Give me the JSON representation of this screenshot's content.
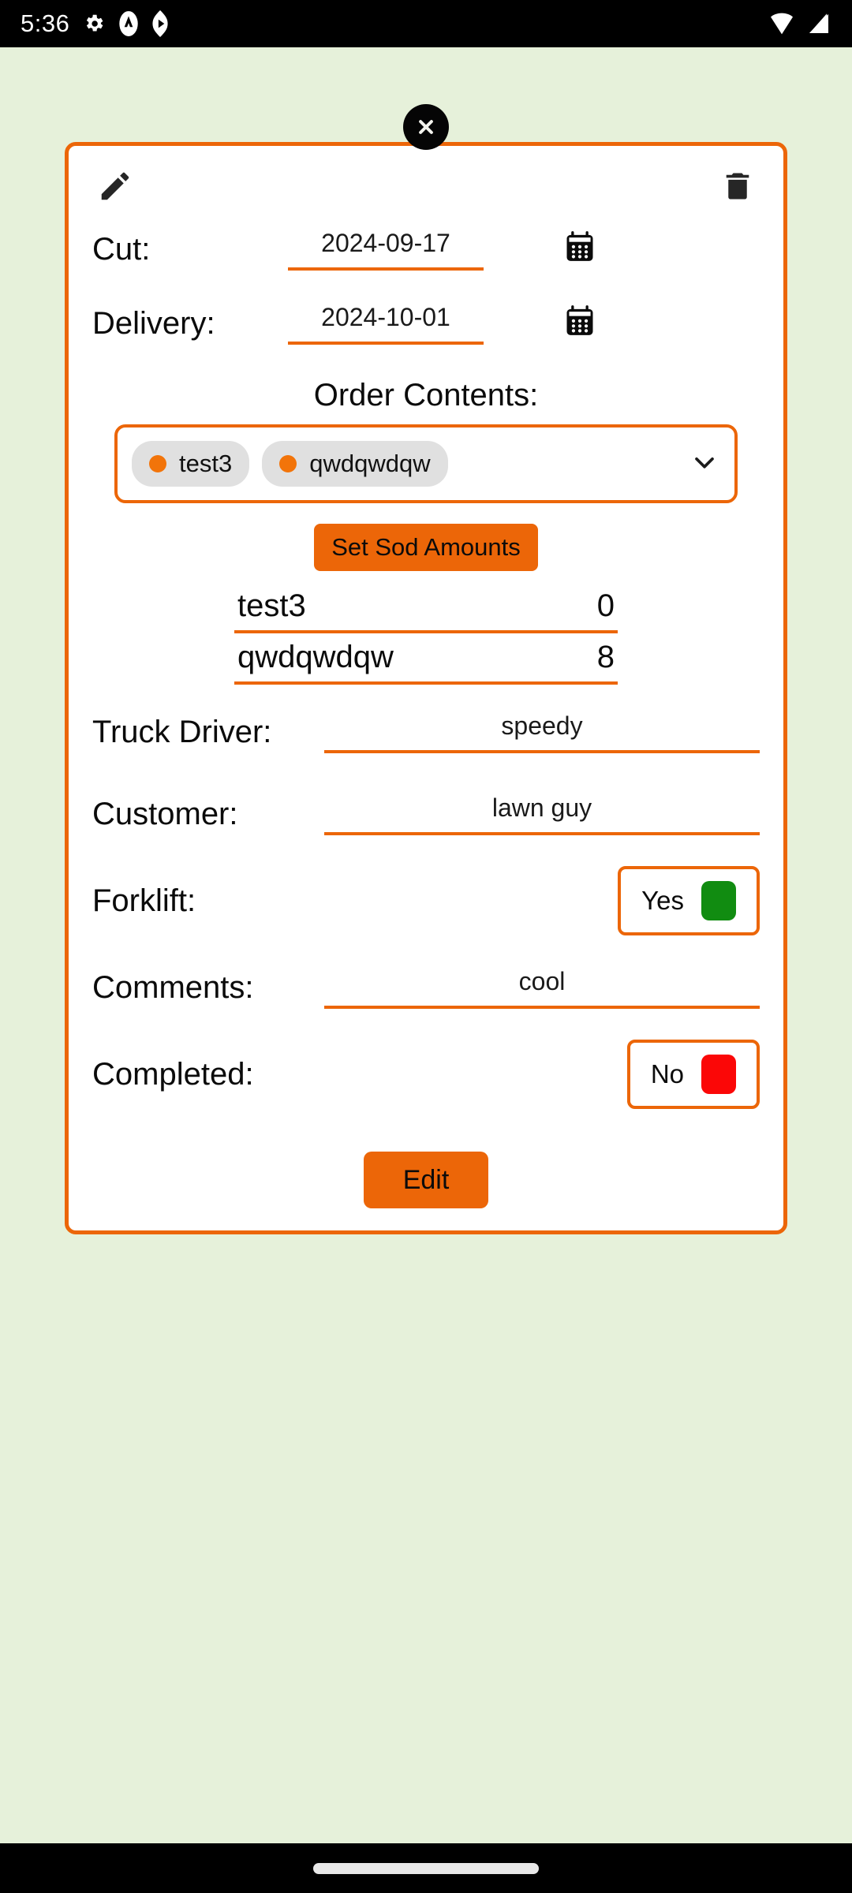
{
  "status_bar": {
    "time": "5:36",
    "left_icons": [
      "gear-icon",
      "android-head-icon",
      "play-badge-icon"
    ],
    "right_icons": [
      "wifi-icon",
      "signal-icon"
    ]
  },
  "colors": {
    "accent_orange": "#ec6608",
    "chip_dot_orange": "#f2740a",
    "background_green": "#e6f1da",
    "card_white": "#ffffff",
    "yes_green": "#118c11",
    "no_red": "#fb0707"
  },
  "dialog": {
    "close_label": "close",
    "header": {
      "edit_icon": "pencil-icon",
      "delete_icon": "trash-icon"
    },
    "fields": {
      "cut": {
        "label": "Cut:",
        "value": "2024-09-17",
        "icon": "calendar-icon"
      },
      "delivery": {
        "label": "Delivery:",
        "value": "2024-10-01",
        "icon": "calendar-icon"
      },
      "truck_driver": {
        "label": "Truck Driver:",
        "value": "speedy"
      },
      "customer": {
        "label": "Customer:",
        "value": "lawn guy"
      },
      "comments": {
        "label": "Comments:",
        "value": "cool"
      },
      "forklift": {
        "label": "Forklift:",
        "value": "Yes",
        "swatch": "#118c11"
      },
      "completed": {
        "label": "Completed:",
        "value": "No",
        "swatch": "#fb0707"
      }
    },
    "order_contents": {
      "title": "Order Contents:",
      "chips": [
        {
          "label": "test3"
        },
        {
          "label": "qwdqwdqw"
        }
      ],
      "expand_icon": "chevron-down-icon"
    },
    "sod": {
      "button_label": "Set Sod Amounts",
      "rows": [
        {
          "name": "test3",
          "qty": "0"
        },
        {
          "name": "qwdqwdqw",
          "qty": "8"
        }
      ]
    },
    "primary_action": {
      "label": "Edit"
    }
  }
}
